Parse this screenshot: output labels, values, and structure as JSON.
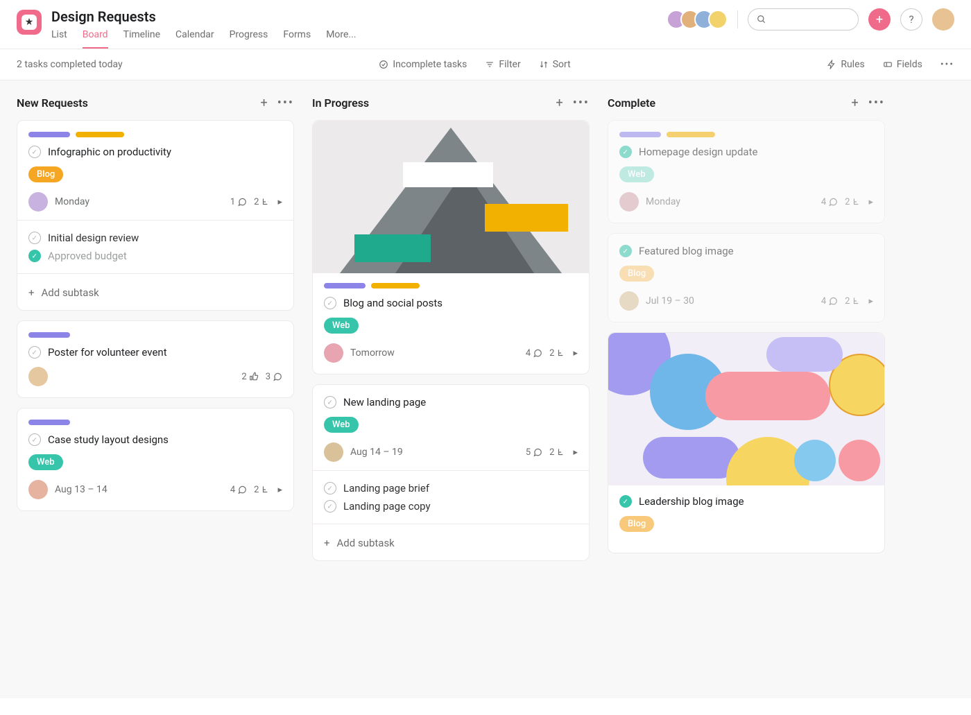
{
  "header": {
    "title": "Design Requests",
    "tabs": [
      "List",
      "Board",
      "Timeline",
      "Calendar",
      "Progress",
      "Forms",
      "More..."
    ],
    "active_tab": "Board",
    "search_placeholder": ""
  },
  "toolbar": {
    "status": "2 tasks completed today",
    "incomplete": "Incomplete tasks",
    "filter": "Filter",
    "sort": "Sort",
    "rules": "Rules",
    "fields": "Fields"
  },
  "columns": [
    {
      "name": "New Requests",
      "cards": [
        {
          "pills": [
            "purple",
            "yellow"
          ],
          "title": "Infographic on productivity",
          "tag": {
            "label": "Blog",
            "style": "blog"
          },
          "date": "Monday",
          "stats": {
            "a": "1",
            "b": "2"
          },
          "icon_a": "comment",
          "icon_b": "subtask",
          "subtasks": [
            {
              "title": "Initial design review",
              "done": false
            },
            {
              "title": "Approved budget",
              "done": true
            }
          ],
          "add_subtask": "Add subtask"
        },
        {
          "pills": [
            "purple"
          ],
          "title": "Poster for volunteer event",
          "date": "",
          "stats": {
            "a": "2",
            "b": "3"
          },
          "icon_a": "like",
          "icon_b": "comment"
        },
        {
          "pills": [
            "purple"
          ],
          "title": "Case study layout designs",
          "tag": {
            "label": "Web",
            "style": "web"
          },
          "date": "Aug 13 – 14",
          "stats": {
            "a": "4",
            "b": "2"
          },
          "icon_a": "comment",
          "icon_b": "subtask"
        }
      ]
    },
    {
      "name": "In Progress",
      "cards": [
        {
          "cover": "mountain",
          "pills": [
            "purple",
            "yellow"
          ],
          "title": "Blog and social posts",
          "tag": {
            "label": "Web",
            "style": "web"
          },
          "date": "Tomorrow",
          "stats": {
            "a": "4",
            "b": "2"
          },
          "icon_a": "comment",
          "icon_b": "subtask"
        },
        {
          "title": "New landing page",
          "tag": {
            "label": "Web",
            "style": "web"
          },
          "date": "Aug 14 – 19",
          "stats": {
            "a": "5",
            "b": "2"
          },
          "icon_a": "comment",
          "icon_b": "subtask",
          "subtasks": [
            {
              "title": "Landing page brief",
              "done": false
            },
            {
              "title": "Landing page copy",
              "done": false
            }
          ],
          "add_subtask": "Add subtask"
        }
      ]
    },
    {
      "name": "Complete",
      "cards": [
        {
          "faded": true,
          "pills": [
            "purple",
            "yellow"
          ],
          "done": true,
          "title": "Homepage design update",
          "tag": {
            "label": "Web",
            "style": "web-light"
          },
          "date": "Monday",
          "stats": {
            "a": "4",
            "b": "2"
          },
          "icon_a": "comment",
          "icon_b": "subtask"
        },
        {
          "faded": true,
          "done": true,
          "title": "Featured blog image",
          "tag": {
            "label": "Blog",
            "style": "blog-light"
          },
          "date": "Jul 19 – 30",
          "stats": {
            "a": "4",
            "b": "2"
          },
          "icon_a": "comment",
          "icon_b": "subtask"
        },
        {
          "cover": "abstract",
          "done": true,
          "title": "Leadership blog image",
          "tag": {
            "label": "Blog",
            "style": "blog-light"
          }
        }
      ]
    }
  ],
  "avatar_colors": [
    "#c7a2d6",
    "#e2b07a",
    "#8fb1d9",
    "#f2d36b"
  ]
}
